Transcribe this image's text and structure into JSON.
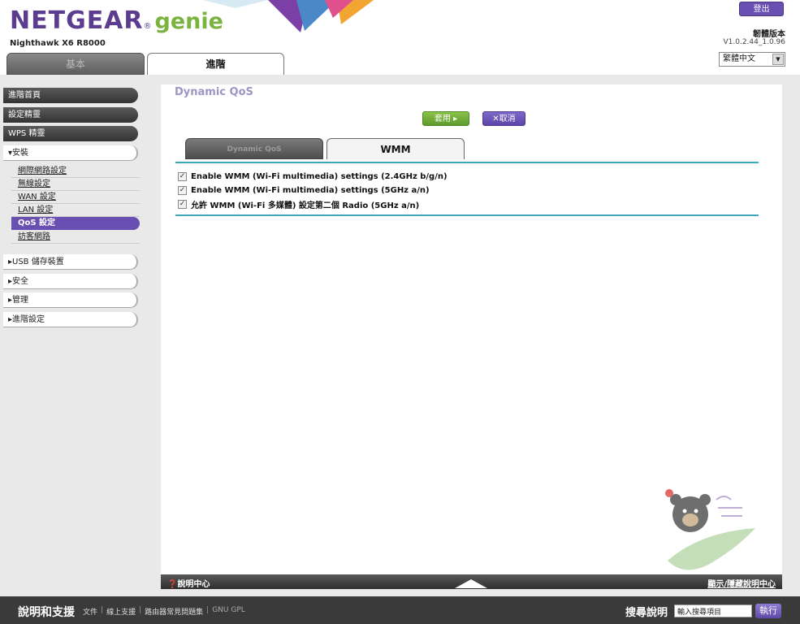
{
  "header": {
    "logo_brand": "NETGEAR",
    "logo_reg": "®",
    "logo_product": "genie",
    "model": "Nighthawk X6 R8000",
    "logout_label": "登出",
    "firmware_label": "韌體版本",
    "firmware_version": "V1.0.2.44_1.0.96",
    "language": "繁體中文"
  },
  "top_tabs": {
    "basic": "基本",
    "advanced": "進階"
  },
  "menu": {
    "home": "進階首頁",
    "setup_wizard": "設定精靈",
    "wps_wizard": "WPS 精靈",
    "setup_section": "▾安裝",
    "setup_items": [
      "網際網路設定",
      "無線設定",
      "WAN 設定",
      "LAN 設定",
      "QoS 設定",
      "訪客網路"
    ],
    "usb": "▸USB 儲存裝置",
    "security": "▸安全",
    "admin": "▸管理",
    "advanced_setup": "▸進階設定"
  },
  "main": {
    "title": "Dynamic QoS",
    "apply_label": "套用 ▸",
    "cancel_label": "✕取消",
    "subtabs": {
      "dynamic_qos": "Dynamic QoS",
      "wmm": "WMM"
    },
    "options": [
      {
        "label": "Enable WMM (Wi-Fi multimedia) settings (2.4GHz b/g/n)",
        "checked": true
      },
      {
        "label": "Enable WMM (Wi-Fi multimedia) settings (5GHz a/n)",
        "checked": true
      },
      {
        "label": "允許 WMM (Wi-Fi 多媒體) 設定第二個 Radio (5GHz a/n)",
        "checked": true
      }
    ]
  },
  "help_bar": {
    "center": "❓說明中心",
    "toggle": "顯示/隱藏說明中心"
  },
  "footer": {
    "title": "說明和支援",
    "links": [
      "文件",
      "線上支援",
      "路由器常見問題集"
    ],
    "gnu": "GNU GPL",
    "search_label": "搜尋說明",
    "search_placeholder": "輸入搜尋項目",
    "go_label": "執行"
  },
  "colors": {
    "brand_purple": "#5b3c8f",
    "genie_green": "#7ab340",
    "accent_teal": "#3da9b8",
    "active_purple": "#6a4fb3"
  }
}
